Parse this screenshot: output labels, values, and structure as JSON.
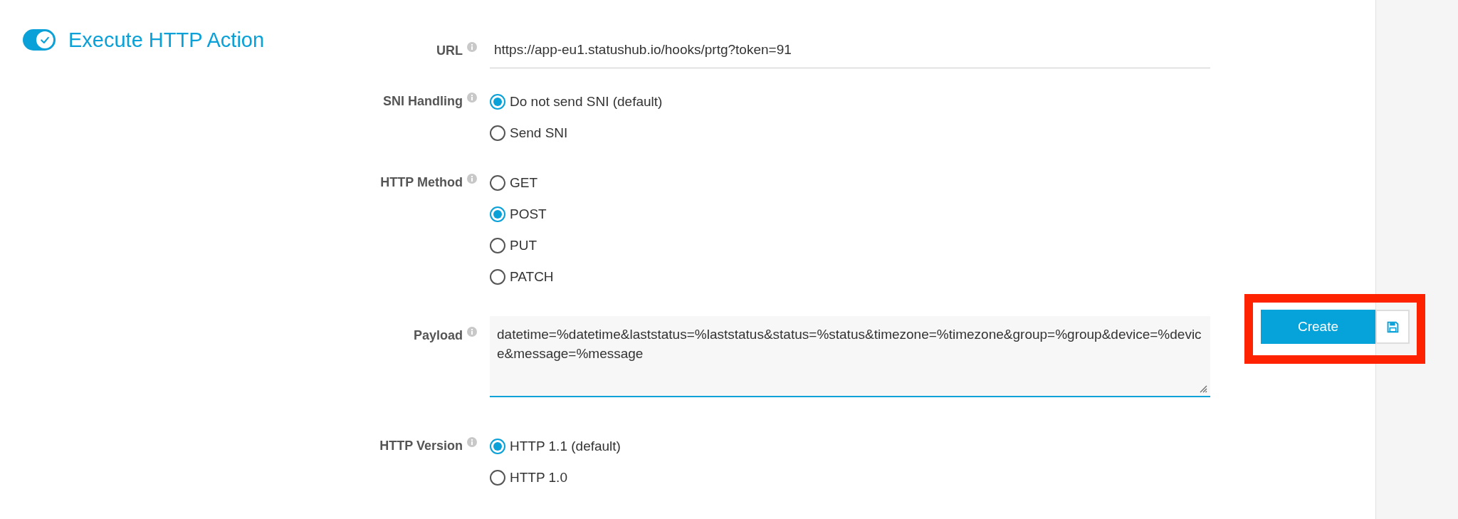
{
  "toggle": {
    "on": true,
    "label": "Execute HTTP Action"
  },
  "fields": [
    {
      "kind": "text",
      "label": "URL",
      "value": "https://app-eu1.statushub.io/hooks/prtg?token=91"
    },
    {
      "kind": "radio",
      "label": "SNI Handling",
      "options": [
        {
          "label": "Do not send SNI (default)",
          "selected": true
        },
        {
          "label": "Send SNI",
          "selected": false
        }
      ]
    },
    {
      "kind": "radio",
      "label": "HTTP Method",
      "options": [
        {
          "label": "GET",
          "selected": false
        },
        {
          "label": "POST",
          "selected": true
        },
        {
          "label": "PUT",
          "selected": false
        },
        {
          "label": "PATCH",
          "selected": false
        }
      ]
    },
    {
      "kind": "textarea",
      "label": "Payload",
      "value": "datetime=%datetime&laststatus=%laststatus&status=%status&timezone=%timezone&group=%group&device=%device&message=%message"
    },
    {
      "kind": "radio",
      "label": "HTTP Version",
      "options": [
        {
          "label": "HTTP 1.1 (default)",
          "selected": true
        },
        {
          "label": "HTTP 1.0",
          "selected": false
        }
      ]
    }
  ],
  "actions": {
    "create": "Create",
    "highlighted": true
  }
}
